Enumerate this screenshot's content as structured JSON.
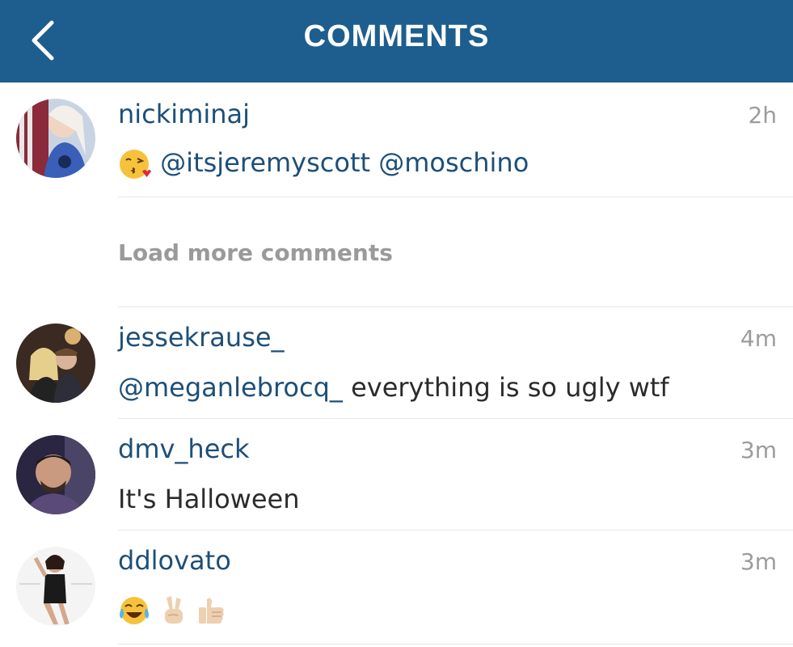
{
  "header": {
    "title": "COMMENTS",
    "back_icon": "chevron-left-icon",
    "background": "#1d5e8e"
  },
  "comments": [
    {
      "username": "nickiminaj",
      "time": "2h",
      "emoji_prefix": "kissing-heart-emoji",
      "mentions": [
        "@itsjeremyscott",
        "@moschino"
      ],
      "text": ""
    },
    {
      "username": "jessekrause_",
      "time": "4m",
      "mentions": [
        "@meganlebrocq_"
      ],
      "text": " everything is so ugly wtf"
    },
    {
      "username": "dmv_heck",
      "time": "3m",
      "text": "It's Halloween"
    },
    {
      "username": "ddlovato",
      "time": "3m",
      "emojis": [
        "tears-of-joy-emoji",
        "victory-hand-emoji",
        "thumbs-up-emoji"
      ],
      "text": ""
    }
  ],
  "load_more": "Load more comments",
  "colors": {
    "username": "#1d4f78",
    "timestamp": "#9c9c9c",
    "load_more": "#9a9a9a"
  }
}
